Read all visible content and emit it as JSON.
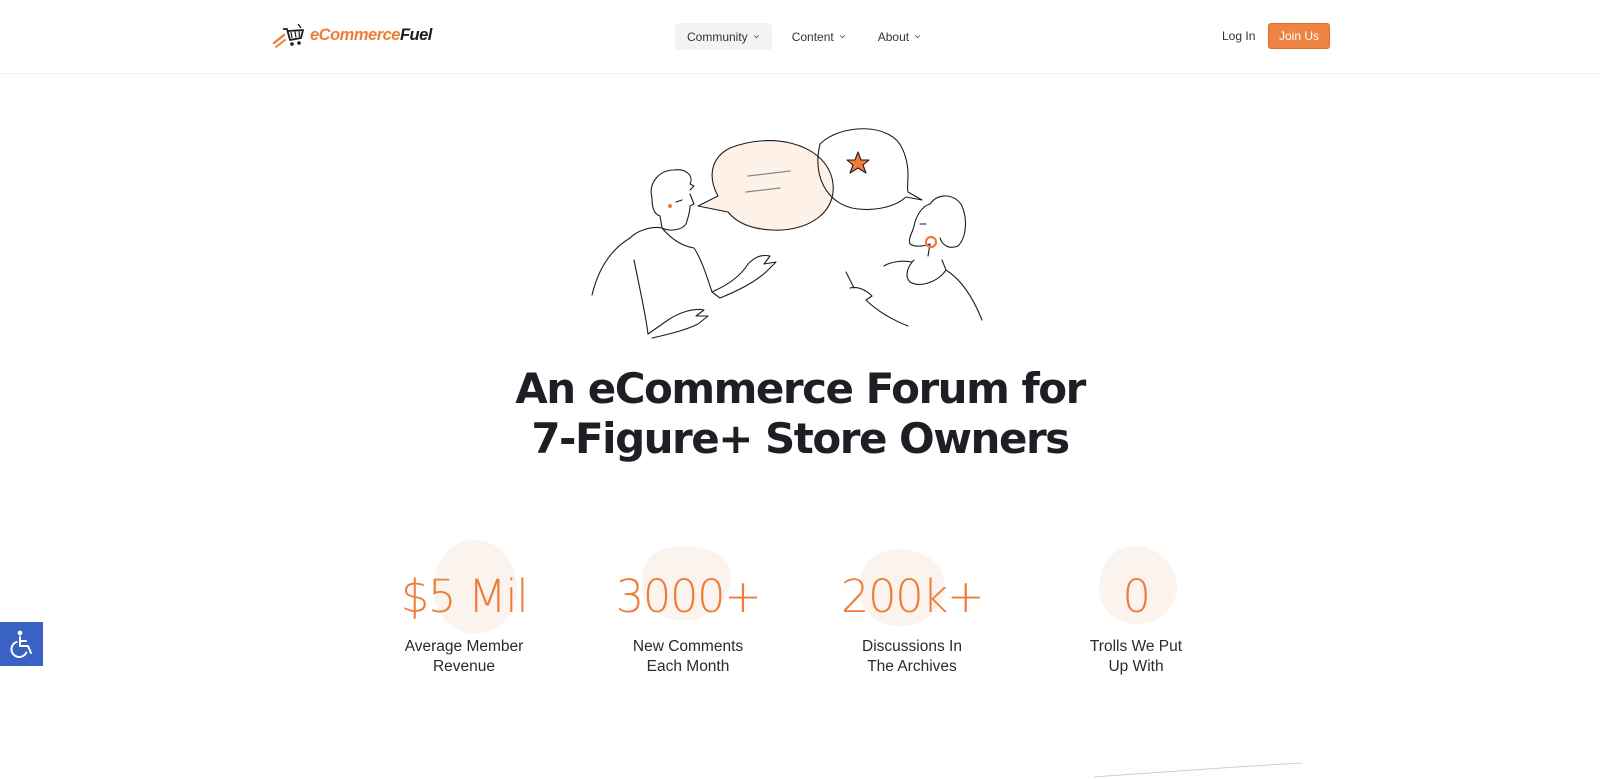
{
  "header": {
    "logo": {
      "prefix": "eCommerce",
      "suffix": "Fuel"
    },
    "nav": [
      {
        "label": "Community",
        "active": true
      },
      {
        "label": "Content",
        "active": false
      },
      {
        "label": "About",
        "active": false
      }
    ],
    "login_label": "Log In",
    "join_label": "Join Us"
  },
  "hero": {
    "headline_line1": "An eCommerce Forum for",
    "headline_line2": "7-Figure+ Store Owners"
  },
  "stats": [
    {
      "value": "$5 Mil",
      "label_line1": "Average Member",
      "label_line2": "Revenue"
    },
    {
      "value": "3000+",
      "label_line1": "New Comments",
      "label_line2": "Each Month"
    },
    {
      "value": "200k+",
      "label_line1": "Discussions In",
      "label_line2": "The Archives"
    },
    {
      "value": "0",
      "label_line1": "Trolls We Put",
      "label_line2": "Up With"
    }
  ],
  "colors": {
    "accent": "#ee7d3a",
    "button": "#ee8444",
    "headline": "#1d1f24",
    "accessibility": "#3a62c4",
    "blob": "#fbf3ee"
  },
  "icons": {
    "accessibility": "wheelchair-icon",
    "caret": "chevron-down-icon",
    "logo": "shopping-cart-rocket-icon"
  }
}
